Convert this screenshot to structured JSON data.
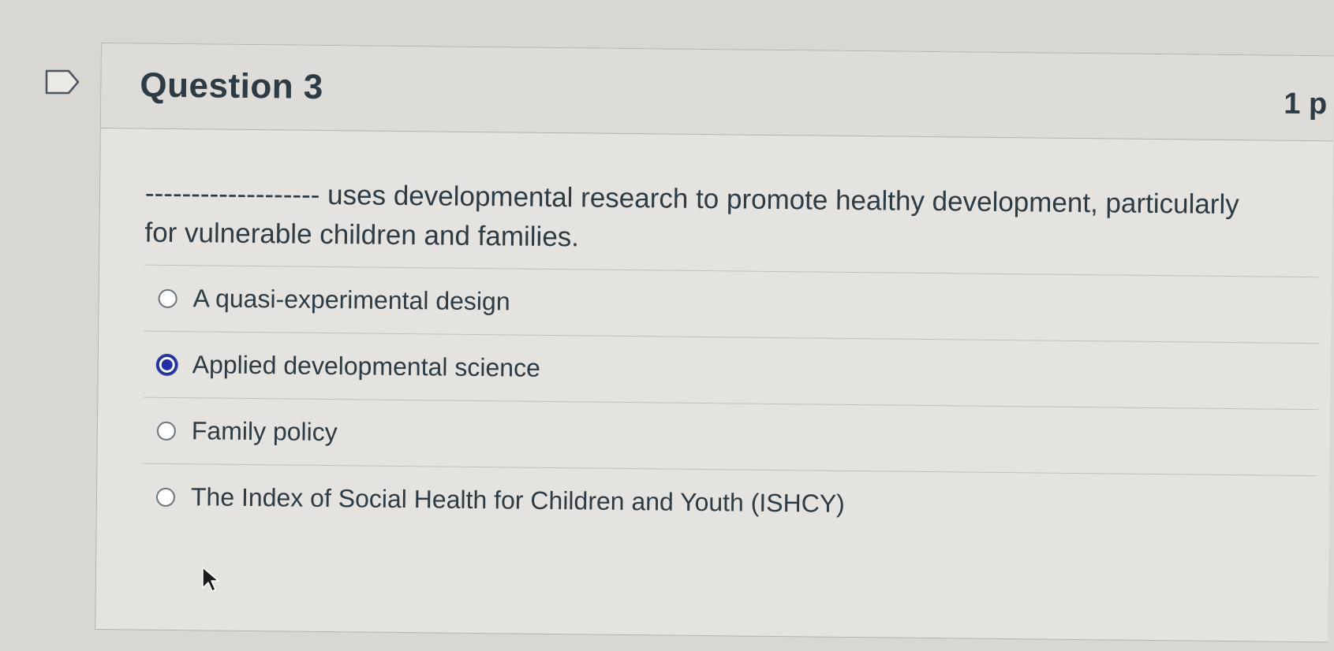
{
  "question": {
    "title": "Question 3",
    "points": "1 p",
    "text": "------------------- uses developmental research to promote healthy development, particularly for vulnerable children and families."
  },
  "answers": [
    {
      "label": "A quasi-experimental design",
      "selected": false
    },
    {
      "label": "Applied developmental science",
      "selected": true
    },
    {
      "label": "Family policy",
      "selected": false
    },
    {
      "label": "The Index of Social Health for Children and Youth (ISHCY)",
      "selected": false
    }
  ],
  "icons": {
    "flag": "flag-question-icon",
    "cursor": "mouse-pointer-icon"
  },
  "colors": {
    "selected_radio": "#2430a8",
    "text": "#2d3b45"
  }
}
